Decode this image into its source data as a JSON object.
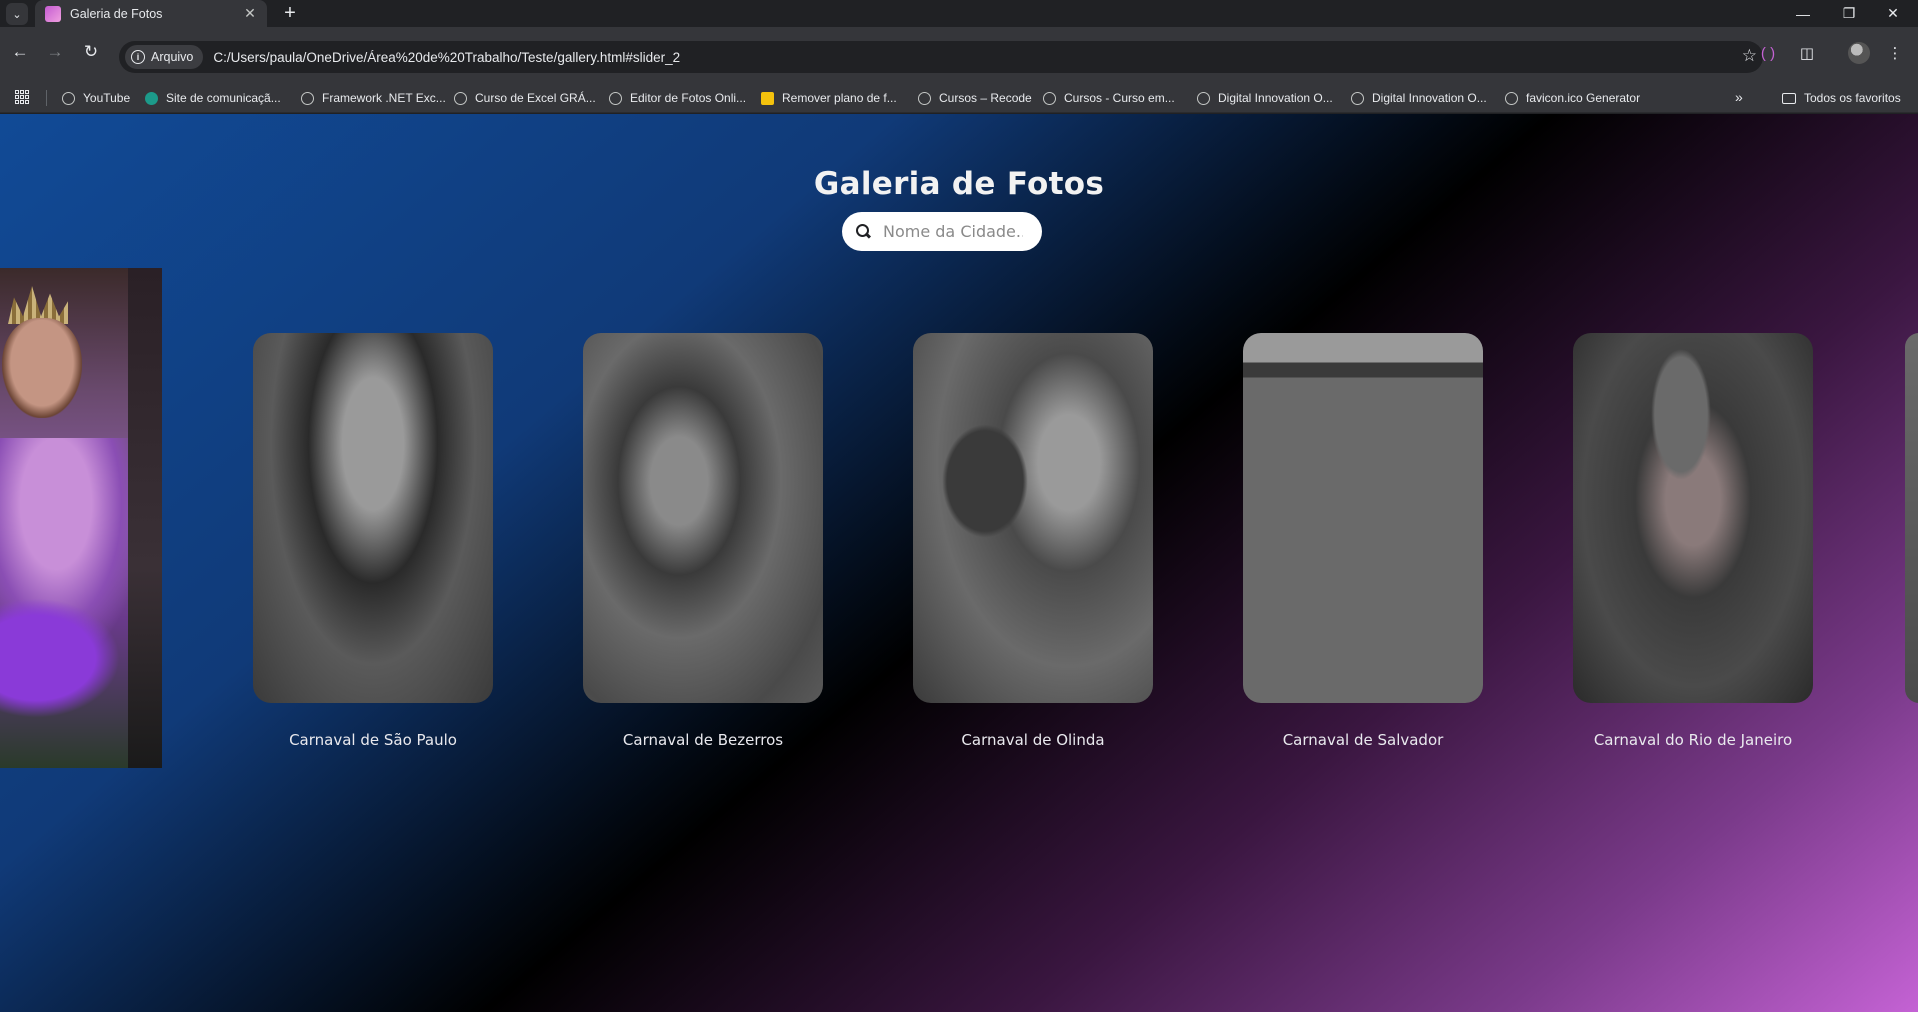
{
  "browser": {
    "tab_title": "Galeria de Fotos",
    "url_chip": "Arquivo",
    "url": "C:/Users/paula/OneDrive/Área%20de%20Trabalho/Teste/gallery.html#slider_2",
    "bookmarks": [
      {
        "label": "YouTube",
        "icon": "globe"
      },
      {
        "label": "Site de comunicaçã...",
        "icon": "s"
      },
      {
        "label": "Framework .NET Exc...",
        "icon": "globe"
      },
      {
        "label": "Curso de Excel GRÁ...",
        "icon": "globe"
      },
      {
        "label": "Editor de Fotos Onli...",
        "icon": "globe"
      },
      {
        "label": "Remover plano de f...",
        "icon": "y"
      },
      {
        "label": "Cursos – Recode",
        "icon": "globe"
      },
      {
        "label": "Cursos - Curso em...",
        "icon": "globe"
      },
      {
        "label": "Digital Innovation O...",
        "icon": "globe"
      },
      {
        "label": "Digital Innovation O...",
        "icon": "globe"
      },
      {
        "label": "favicon.ico Generator",
        "icon": "globe"
      }
    ],
    "all_bookmarks": "Todos os favoritos"
  },
  "page": {
    "title": "Galeria de Fotos",
    "search_placeholder": "Nome da Cidade..",
    "cards": [
      {
        "label": "Carnaval de São Paulo"
      },
      {
        "label": "Carnaval de Bezerros"
      },
      {
        "label": "Carnaval de Olinda"
      },
      {
        "label": "Carnaval de Salvador"
      },
      {
        "label": "Carnaval do Rio de Janeiro"
      }
    ]
  },
  "colors": {
    "background_gradient": [
      "#114a96",
      "#000000",
      "#c462d4"
    ],
    "card_text": "#e9e9ee"
  }
}
